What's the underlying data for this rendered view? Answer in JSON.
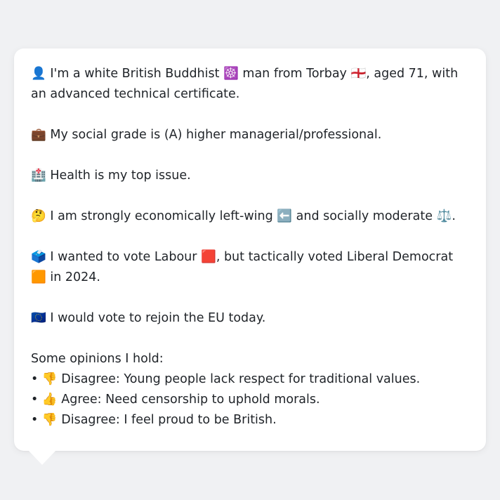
{
  "profile": {
    "identity": "👤 I'm a white British Buddhist ☸️ man from Torbay 🏴󠁧󠁢󠁥󠁮󠁧󠁿, aged 71, with an advanced technical certificate.",
    "social_grade": "💼 My social grade is (A) higher managerial/professional.",
    "top_issue": "🏥 Health is my top issue.",
    "economics": "🤔 I am strongly economically left-wing ⬅️ and socially moderate ⚖️.",
    "vote": "🗳️ I wanted to vote Labour 🟥, but tactically voted Liberal Democrat 🟧 in 2024.",
    "eu": "🇪🇺 I would vote to rejoin the EU today."
  },
  "opinions": {
    "heading": "Some opinions I hold:",
    "items": [
      "• 👎 Disagree: Young people lack respect for traditional values.",
      "• 👍 Agree: Need censorship to uphold morals.",
      "• 👎 Disagree: I feel proud to be British."
    ]
  }
}
